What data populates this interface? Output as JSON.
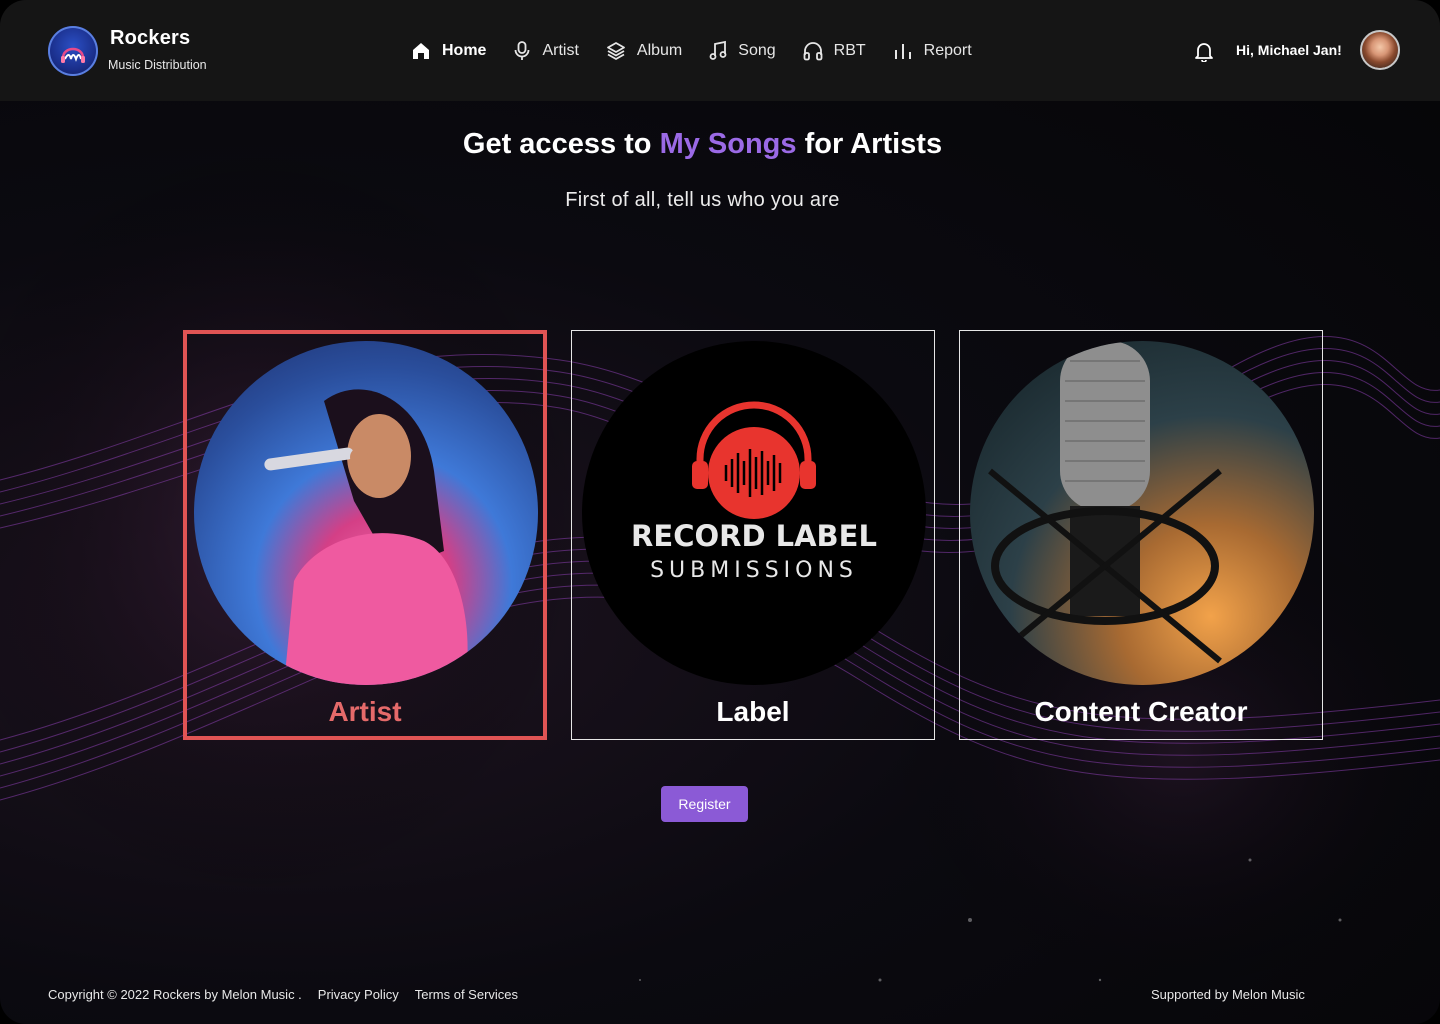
{
  "brand": {
    "title": "Rockers",
    "subtitle": "Music Distribution"
  },
  "nav": [
    {
      "label": "Home",
      "icon": "home-icon",
      "active": true
    },
    {
      "label": "Artist",
      "icon": "microphone-icon",
      "active": false
    },
    {
      "label": "Album",
      "icon": "layers-icon",
      "active": false
    },
    {
      "label": "Song",
      "icon": "music-note-icon",
      "active": false
    },
    {
      "label": "RBT",
      "icon": "headphones-icon",
      "active": false
    },
    {
      "label": "Report",
      "icon": "bar-chart-icon",
      "active": false
    }
  ],
  "user": {
    "greeting": "Hi, Michael Jan!"
  },
  "hero": {
    "title_prefix": "Get access to ",
    "title_accent": "My Songs",
    "title_suffix": " for Artists",
    "subtitle": "First of all, tell us who you are"
  },
  "cards": [
    {
      "label": "Artist",
      "selected": true
    },
    {
      "label": "Label",
      "selected": false,
      "image_text_line1": "RECORD LABEL",
      "image_text_line2": "SUBMISSIONS"
    },
    {
      "label": "Content Creator",
      "selected": false
    }
  ],
  "register_label": "Register",
  "footer": {
    "copyright": "Copyright © 2022 Rockers by Melon Music .",
    "privacy": "Privacy Policy",
    "terms": "Terms of Services",
    "supported": "Supported by Melon Music"
  },
  "colors": {
    "accent": "#9b6ae6",
    "button": "#8b5ad6",
    "selected_border": "#e05454",
    "header_bg": "#151515"
  }
}
